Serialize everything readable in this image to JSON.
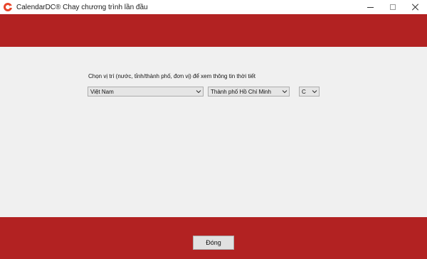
{
  "window": {
    "title": "CalendarDC® Chay chương trình lần đầu",
    "icon": "calendardc-logo-icon",
    "controls": [
      "minimize-icon",
      "maximize-icon",
      "close-icon"
    ]
  },
  "colors": {
    "band": "#b22222",
    "content_bg": "#f0f0f0",
    "icon": "#e8442a"
  },
  "location": {
    "prompt": "Chọn vị trí (nước, tỉnh/thành phố, đơn vị) để xem thông tin thời tiết",
    "country": "Việt Nam",
    "city": "Thành phố Hồ Chí Minh",
    "unit": "C"
  },
  "footer": {
    "close_label": "Đóng"
  }
}
